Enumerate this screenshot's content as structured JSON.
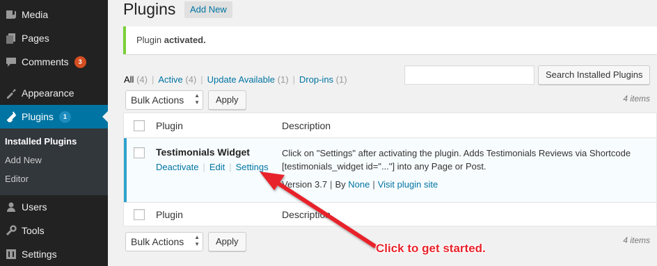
{
  "sidebar": {
    "items": [
      {
        "label": "Media",
        "icon": "media-icon"
      },
      {
        "label": "Pages",
        "icon": "pages-icon"
      },
      {
        "label": "Comments",
        "icon": "comments-icon",
        "badge": "3"
      },
      {
        "label": "Appearance",
        "icon": "appearance-icon"
      },
      {
        "label": "Plugins",
        "icon": "plugins-icon",
        "badge": "1"
      },
      {
        "label": "Users",
        "icon": "users-icon"
      },
      {
        "label": "Tools",
        "icon": "tools-icon"
      },
      {
        "label": "Settings",
        "icon": "settings-icon"
      }
    ],
    "submenu": [
      "Installed Plugins",
      "Add New",
      "Editor"
    ]
  },
  "header": {
    "title": "Plugins",
    "add_new": "Add New"
  },
  "notice": {
    "prefix": "Plugin",
    "strong": "activated."
  },
  "filters": [
    {
      "label": "All",
      "count": "(4)"
    },
    {
      "label": "Active",
      "count": "(4)"
    },
    {
      "label": "Update Available",
      "count": "(1)"
    },
    {
      "label": "Drop-ins",
      "count": "(1)"
    }
  ],
  "search": {
    "button": "Search Installed Plugins",
    "placeholder": ""
  },
  "bulk": {
    "select_label": "Bulk Actions",
    "apply": "Apply",
    "items_count": "4 items"
  },
  "table": {
    "col_plugin": "Plugin",
    "col_description": "Description",
    "rows": [
      {
        "name": "Testimonials Widget",
        "actions": [
          "Deactivate",
          "Edit",
          "Settings"
        ],
        "description": "Click on \"Settings\" after activating the plugin. Adds Testimonials Reviews via Shortcode [testimonials_widget id=\"...\"] into any Page or Post.",
        "version": "Version 3.7",
        "by_label": "By",
        "author": "None",
        "site_link": "Visit plugin site"
      }
    ]
  },
  "annotation": {
    "text": "Click to get started."
  },
  "colors": {
    "accent": "#0074a2",
    "notice_border": "#7ad03a",
    "annotation": "#e8232b"
  }
}
